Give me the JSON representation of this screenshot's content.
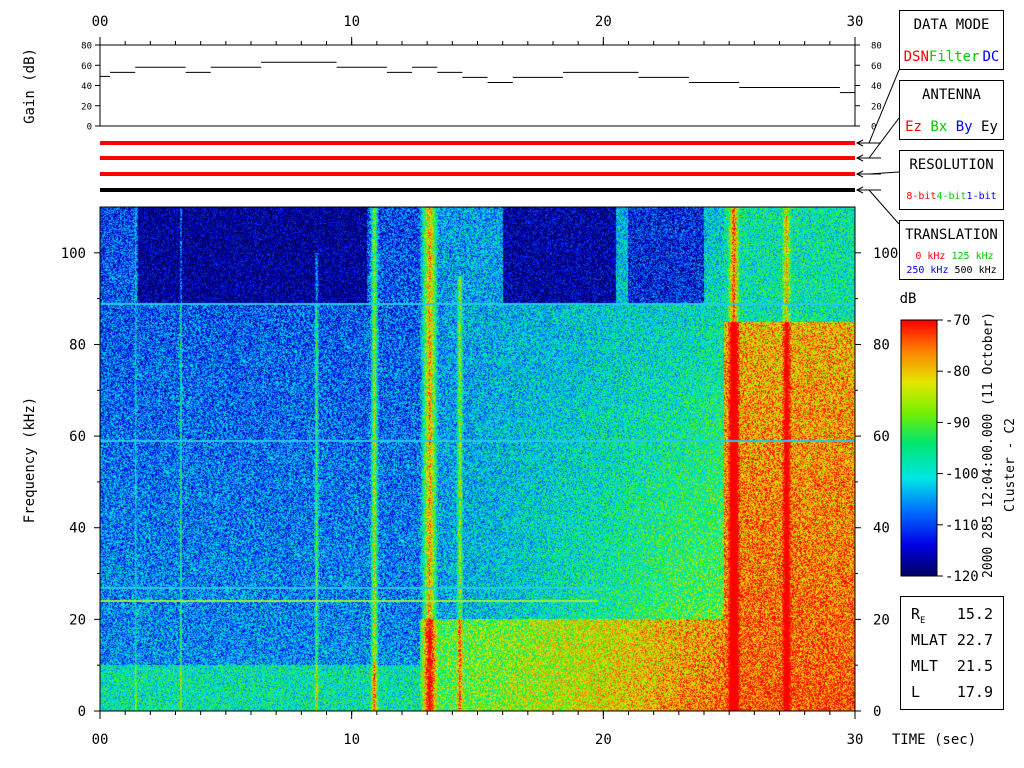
{
  "chart_data": [
    {
      "type": "line",
      "name": "gain-panel",
      "ylabel": "Gain (dB)",
      "xlim": [
        0,
        30
      ],
      "ylim": [
        0,
        80
      ],
      "x_ticks": [
        "00",
        "10",
        "20",
        "30"
      ],
      "x_tick_values": [
        0,
        10,
        20,
        30
      ],
      "y_ticks": [
        "80",
        "60",
        "40",
        "20",
        "0"
      ],
      "y_tick_values": [
        80,
        60,
        40,
        20,
        0
      ],
      "gain_steps": [
        {
          "t0": 0.0,
          "t1": 0.4,
          "v": 49
        },
        {
          "t0": 0.4,
          "t1": 1.4,
          "v": 53
        },
        {
          "t0": 1.4,
          "t1": 3.4,
          "v": 58
        },
        {
          "t0": 3.4,
          "t1": 4.4,
          "v": 53
        },
        {
          "t0": 4.4,
          "t1": 6.4,
          "v": 58
        },
        {
          "t0": 6.4,
          "t1": 9.4,
          "v": 63
        },
        {
          "t0": 9.4,
          "t1": 11.4,
          "v": 58
        },
        {
          "t0": 11.4,
          "t1": 12.4,
          "v": 53
        },
        {
          "t0": 12.4,
          "t1": 13.4,
          "v": 58
        },
        {
          "t0": 13.4,
          "t1": 14.4,
          "v": 53
        },
        {
          "t0": 14.4,
          "t1": 15.4,
          "v": 48
        },
        {
          "t0": 15.4,
          "t1": 16.4,
          "v": 43
        },
        {
          "t0": 16.4,
          "t1": 18.4,
          "v": 48
        },
        {
          "t0": 18.4,
          "t1": 21.4,
          "v": 53
        },
        {
          "t0": 21.4,
          "t1": 23.4,
          "v": 48
        },
        {
          "t0": 23.4,
          "t1": 25.4,
          "v": 43
        },
        {
          "t0": 25.4,
          "t1": 29.4,
          "v": 38
        },
        {
          "t0": 29.4,
          "t1": 30.0,
          "v": 33
        }
      ]
    },
    {
      "type": "heatmap",
      "name": "spectrogram",
      "xlabel": "TIME (sec)",
      "ylabel": "Frequency (kHz)",
      "xlim": [
        0,
        30
      ],
      "ylim": [
        0,
        110
      ],
      "x_ticks": [
        "00",
        "10",
        "20",
        "30"
      ],
      "x_tick_values": [
        0,
        10,
        20,
        30
      ],
      "y_ticks": [
        "0",
        "20",
        "40",
        "60",
        "80",
        "100"
      ],
      "y_tick_values": [
        0,
        20,
        40,
        60,
        80,
        100
      ],
      "colorbar": {
        "unit": "dB",
        "range": [
          -120,
          -70
        ],
        "ticks": [
          "-70",
          "-80",
          "-90",
          "-100",
          "-110",
          "-120"
        ],
        "tick_values": [
          -70,
          -80,
          -90,
          -100,
          -110,
          -120
        ]
      },
      "interference_lines_khz": [
        89,
        59,
        27,
        24
      ],
      "description_text": "2000 285 12:04:00.000 (11 October)",
      "spacecraft": "Cluster - C2"
    }
  ],
  "mode_bars": [
    {
      "color": "#ff0000"
    },
    {
      "color": "#ff0000"
    },
    {
      "color": "#ff0000"
    },
    {
      "color": "#000000"
    }
  ],
  "legend_boxes": {
    "data_mode": {
      "title": "DATA MODE",
      "items": [
        {
          "label": "DSN",
          "color": "#ff0000"
        },
        {
          "label": "Filter",
          "color": "#00cc00"
        },
        {
          "label": "DC",
          "color": "#0000ff"
        }
      ]
    },
    "antenna": {
      "title": "ANTENNA",
      "items": [
        {
          "label": "Ez",
          "color": "#ff0000"
        },
        {
          "label": "Bx",
          "color": "#00cc00"
        },
        {
          "label": "By",
          "color": "#0000ff"
        },
        {
          "label": "Ey",
          "color": "#000000"
        }
      ]
    },
    "resolution": {
      "title": "RESOLUTION",
      "items": [
        {
          "label": "8-bit",
          "color": "#ff0000"
        },
        {
          "label": "4-bit",
          "color": "#00cc00"
        },
        {
          "label": "1-bit",
          "color": "#0000ff"
        }
      ]
    },
    "translation": {
      "title": "TRANSLATION",
      "row1": [
        {
          "label": "0 kHz",
          "color": "#ff0000"
        },
        {
          "label": "125 kHz",
          "color": "#00cc00"
        }
      ],
      "row2": [
        {
          "label": "250 kHz",
          "color": "#0000ff"
        },
        {
          "label": "500 kHz",
          "color": "#000000"
        }
      ]
    }
  },
  "orbit": [
    {
      "label": "RE",
      "value": "15.2"
    },
    {
      "label": "MLAT",
      "value": "22.7"
    },
    {
      "label": "MLT",
      "value": "21.5"
    },
    {
      "label": "L",
      "value": "17.9"
    }
  ]
}
